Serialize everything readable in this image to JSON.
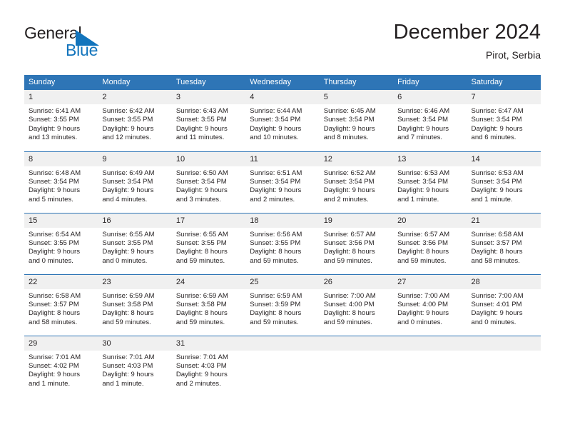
{
  "brand": {
    "name_top": "General",
    "name_bottom": "Blue",
    "triangle_icon": "blue-triangle-icon",
    "blue": "#1274bc"
  },
  "header": {
    "title": "December 2024",
    "subtitle": "Pirot, Serbia"
  },
  "colors": {
    "header_blue": "#2e75b6",
    "daynum_background": "#f0f0f0",
    "text": "#231f20"
  },
  "weekdays": [
    "Sunday",
    "Monday",
    "Tuesday",
    "Wednesday",
    "Thursday",
    "Friday",
    "Saturday"
  ],
  "weeks": [
    [
      {
        "day": "1",
        "sunrise": "Sunrise: 6:41 AM",
        "sunset": "Sunset: 3:55 PM",
        "daylight1": "Daylight: 9 hours",
        "daylight2": "and 13 minutes."
      },
      {
        "day": "2",
        "sunrise": "Sunrise: 6:42 AM",
        "sunset": "Sunset: 3:55 PM",
        "daylight1": "Daylight: 9 hours",
        "daylight2": "and 12 minutes."
      },
      {
        "day": "3",
        "sunrise": "Sunrise: 6:43 AM",
        "sunset": "Sunset: 3:55 PM",
        "daylight1": "Daylight: 9 hours",
        "daylight2": "and 11 minutes."
      },
      {
        "day": "4",
        "sunrise": "Sunrise: 6:44 AM",
        "sunset": "Sunset: 3:54 PM",
        "daylight1": "Daylight: 9 hours",
        "daylight2": "and 10 minutes."
      },
      {
        "day": "5",
        "sunrise": "Sunrise: 6:45 AM",
        "sunset": "Sunset: 3:54 PM",
        "daylight1": "Daylight: 9 hours",
        "daylight2": "and 8 minutes."
      },
      {
        "day": "6",
        "sunrise": "Sunrise: 6:46 AM",
        "sunset": "Sunset: 3:54 PM",
        "daylight1": "Daylight: 9 hours",
        "daylight2": "and 7 minutes."
      },
      {
        "day": "7",
        "sunrise": "Sunrise: 6:47 AM",
        "sunset": "Sunset: 3:54 PM",
        "daylight1": "Daylight: 9 hours",
        "daylight2": "and 6 minutes."
      }
    ],
    [
      {
        "day": "8",
        "sunrise": "Sunrise: 6:48 AM",
        "sunset": "Sunset: 3:54 PM",
        "daylight1": "Daylight: 9 hours",
        "daylight2": "and 5 minutes."
      },
      {
        "day": "9",
        "sunrise": "Sunrise: 6:49 AM",
        "sunset": "Sunset: 3:54 PM",
        "daylight1": "Daylight: 9 hours",
        "daylight2": "and 4 minutes."
      },
      {
        "day": "10",
        "sunrise": "Sunrise: 6:50 AM",
        "sunset": "Sunset: 3:54 PM",
        "daylight1": "Daylight: 9 hours",
        "daylight2": "and 3 minutes."
      },
      {
        "day": "11",
        "sunrise": "Sunrise: 6:51 AM",
        "sunset": "Sunset: 3:54 PM",
        "daylight1": "Daylight: 9 hours",
        "daylight2": "and 2 minutes."
      },
      {
        "day": "12",
        "sunrise": "Sunrise: 6:52 AM",
        "sunset": "Sunset: 3:54 PM",
        "daylight1": "Daylight: 9 hours",
        "daylight2": "and 2 minutes."
      },
      {
        "day": "13",
        "sunrise": "Sunrise: 6:53 AM",
        "sunset": "Sunset: 3:54 PM",
        "daylight1": "Daylight: 9 hours",
        "daylight2": "and 1 minute."
      },
      {
        "day": "14",
        "sunrise": "Sunrise: 6:53 AM",
        "sunset": "Sunset: 3:54 PM",
        "daylight1": "Daylight: 9 hours",
        "daylight2": "and 1 minute."
      }
    ],
    [
      {
        "day": "15",
        "sunrise": "Sunrise: 6:54 AM",
        "sunset": "Sunset: 3:55 PM",
        "daylight1": "Daylight: 9 hours",
        "daylight2": "and 0 minutes."
      },
      {
        "day": "16",
        "sunrise": "Sunrise: 6:55 AM",
        "sunset": "Sunset: 3:55 PM",
        "daylight1": "Daylight: 9 hours",
        "daylight2": "and 0 minutes."
      },
      {
        "day": "17",
        "sunrise": "Sunrise: 6:55 AM",
        "sunset": "Sunset: 3:55 PM",
        "daylight1": "Daylight: 8 hours",
        "daylight2": "and 59 minutes."
      },
      {
        "day": "18",
        "sunrise": "Sunrise: 6:56 AM",
        "sunset": "Sunset: 3:55 PM",
        "daylight1": "Daylight: 8 hours",
        "daylight2": "and 59 minutes."
      },
      {
        "day": "19",
        "sunrise": "Sunrise: 6:57 AM",
        "sunset": "Sunset: 3:56 PM",
        "daylight1": "Daylight: 8 hours",
        "daylight2": "and 59 minutes."
      },
      {
        "day": "20",
        "sunrise": "Sunrise: 6:57 AM",
        "sunset": "Sunset: 3:56 PM",
        "daylight1": "Daylight: 8 hours",
        "daylight2": "and 59 minutes."
      },
      {
        "day": "21",
        "sunrise": "Sunrise: 6:58 AM",
        "sunset": "Sunset: 3:57 PM",
        "daylight1": "Daylight: 8 hours",
        "daylight2": "and 58 minutes."
      }
    ],
    [
      {
        "day": "22",
        "sunrise": "Sunrise: 6:58 AM",
        "sunset": "Sunset: 3:57 PM",
        "daylight1": "Daylight: 8 hours",
        "daylight2": "and 58 minutes."
      },
      {
        "day": "23",
        "sunrise": "Sunrise: 6:59 AM",
        "sunset": "Sunset: 3:58 PM",
        "daylight1": "Daylight: 8 hours",
        "daylight2": "and 59 minutes."
      },
      {
        "day": "24",
        "sunrise": "Sunrise: 6:59 AM",
        "sunset": "Sunset: 3:58 PM",
        "daylight1": "Daylight: 8 hours",
        "daylight2": "and 59 minutes."
      },
      {
        "day": "25",
        "sunrise": "Sunrise: 6:59 AM",
        "sunset": "Sunset: 3:59 PM",
        "daylight1": "Daylight: 8 hours",
        "daylight2": "and 59 minutes."
      },
      {
        "day": "26",
        "sunrise": "Sunrise: 7:00 AM",
        "sunset": "Sunset: 4:00 PM",
        "daylight1": "Daylight: 8 hours",
        "daylight2": "and 59 minutes."
      },
      {
        "day": "27",
        "sunrise": "Sunrise: 7:00 AM",
        "sunset": "Sunset: 4:00 PM",
        "daylight1": "Daylight: 9 hours",
        "daylight2": "and 0 minutes."
      },
      {
        "day": "28",
        "sunrise": "Sunrise: 7:00 AM",
        "sunset": "Sunset: 4:01 PM",
        "daylight1": "Daylight: 9 hours",
        "daylight2": "and 0 minutes."
      }
    ],
    [
      {
        "day": "29",
        "sunrise": "Sunrise: 7:01 AM",
        "sunset": "Sunset: 4:02 PM",
        "daylight1": "Daylight: 9 hours",
        "daylight2": "and 1 minute."
      },
      {
        "day": "30",
        "sunrise": "Sunrise: 7:01 AM",
        "sunset": "Sunset: 4:03 PM",
        "daylight1": "Daylight: 9 hours",
        "daylight2": "and 1 minute."
      },
      {
        "day": "31",
        "sunrise": "Sunrise: 7:01 AM",
        "sunset": "Sunset: 4:03 PM",
        "daylight1": "Daylight: 9 hours",
        "daylight2": "and 2 minutes."
      },
      {
        "day": "",
        "sunrise": "",
        "sunset": "",
        "daylight1": "",
        "daylight2": ""
      },
      {
        "day": "",
        "sunrise": "",
        "sunset": "",
        "daylight1": "",
        "daylight2": ""
      },
      {
        "day": "",
        "sunrise": "",
        "sunset": "",
        "daylight1": "",
        "daylight2": ""
      },
      {
        "day": "",
        "sunrise": "",
        "sunset": "",
        "daylight1": "",
        "daylight2": ""
      }
    ]
  ]
}
